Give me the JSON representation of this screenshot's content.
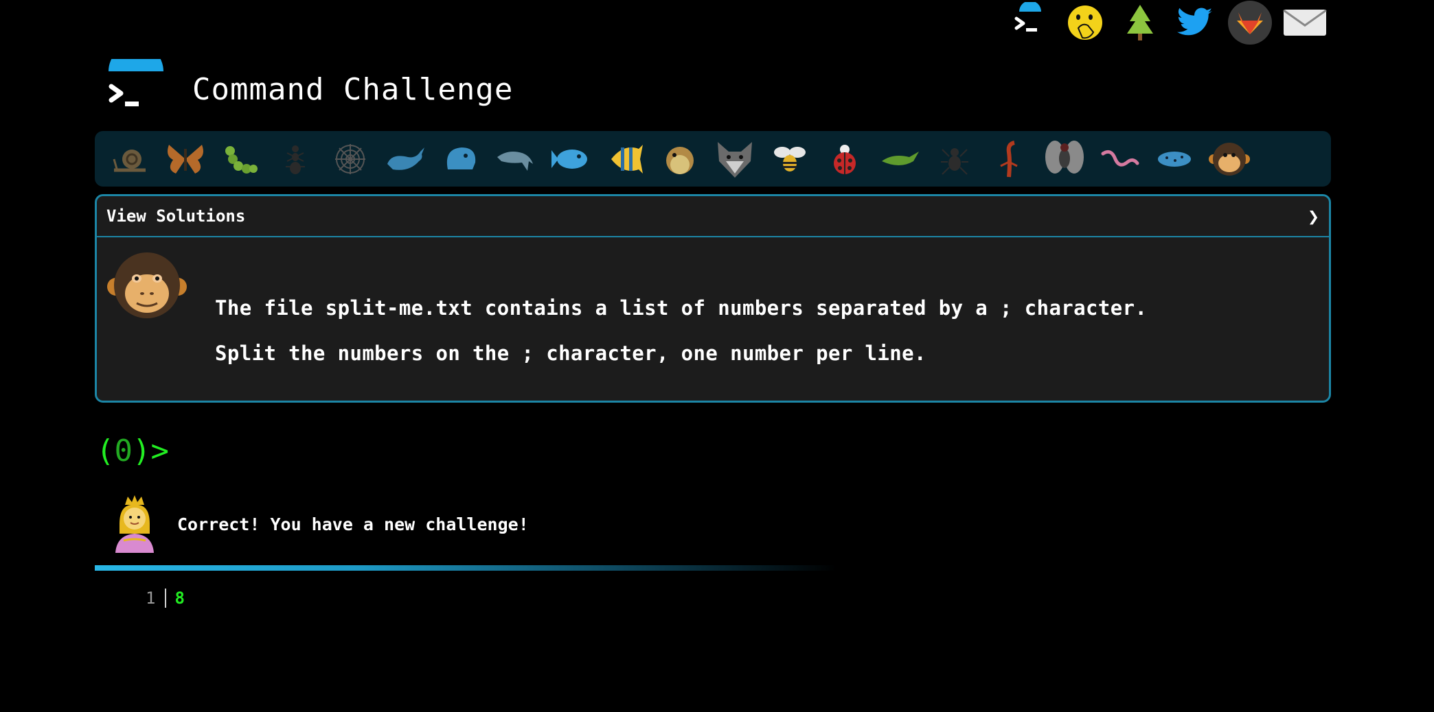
{
  "top_nav": [
    {
      "name": "terminal-icon"
    },
    {
      "name": "face-with-hand-over-mouth-icon"
    },
    {
      "name": "evergreen-tree-icon"
    },
    {
      "name": "twitter-bird-icon"
    },
    {
      "name": "gitlab-fox-icon"
    },
    {
      "name": "envelope-icon"
    }
  ],
  "header": {
    "title": "Command Challenge"
  },
  "levels": [
    "snail",
    "butterfly",
    "caterpillar",
    "ant",
    "spider-web",
    "whale",
    "whale-spouting",
    "dolphin",
    "fish",
    "tropical-fish",
    "blowfish",
    "wolf",
    "bee",
    "ladybug",
    "cricket",
    "spider",
    "scorpion",
    "fly",
    "worm",
    "microbe",
    "monkey"
  ],
  "challenge": {
    "toggle_label": "View Solutions",
    "chevron": "❯",
    "lines": [
      "The file split-me.txt contains a list of numbers separated by a ; character.",
      "Split the numbers on the ; character, one number per line."
    ]
  },
  "prompt": {
    "open": "(",
    "count": "0",
    ")": ")",
    "close": ")>"
  },
  "feedback": {
    "text": "Correct! You have a new challenge!"
  },
  "output": [
    {
      "line": "1",
      "value": "8"
    }
  ],
  "colors": {
    "accent": "#1c86a6",
    "prompt": "#22ee22",
    "levelbar": "#06232e"
  }
}
